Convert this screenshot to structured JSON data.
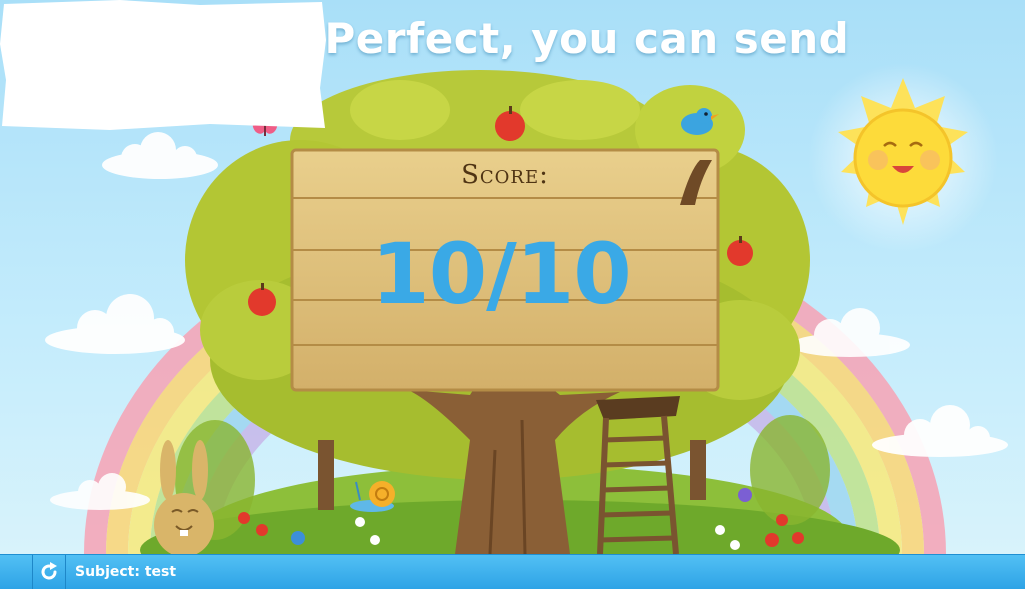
{
  "headline": "Wow! Perfect, you can send",
  "score": {
    "label": "Score:",
    "value": "10/10"
  },
  "bottom_bar": {
    "reload_icon": "reload-icon",
    "subject_text": "Subject: test"
  },
  "colors": {
    "score_blue": "#3aa9e6",
    "bar_blue": "#2ea3e6",
    "sky": "#a9dff8"
  }
}
